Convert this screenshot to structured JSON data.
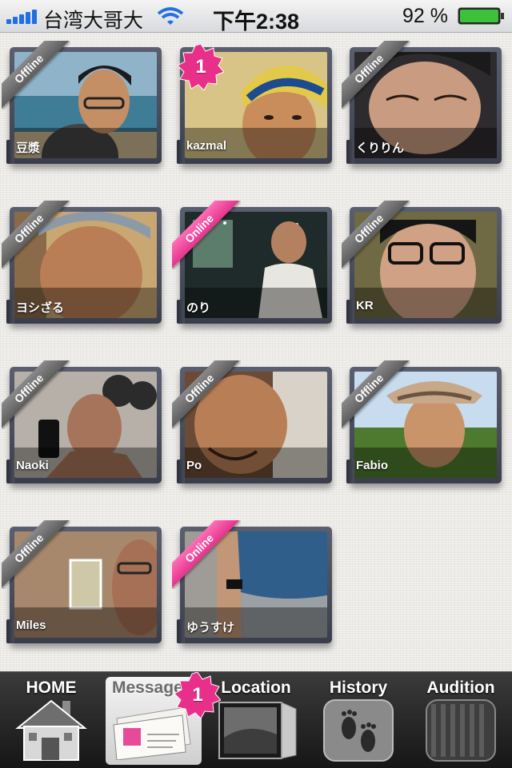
{
  "status_bar": {
    "carrier": "台湾大哥大",
    "time": "下午2:38",
    "battery_percent": "92 %"
  },
  "cards": [
    {
      "name": "豆漿",
      "status": "Offline",
      "badge": ""
    },
    {
      "name": "kazmal",
      "status": "",
      "badge": "1"
    },
    {
      "name": "くりりん",
      "status": "Offline",
      "badge": ""
    },
    {
      "name": "ヨシざる",
      "status": "Offline",
      "badge": ""
    },
    {
      "name": "のり",
      "status": "Online",
      "badge": ""
    },
    {
      "name": "KR",
      "status": "Offline",
      "badge": ""
    },
    {
      "name": "Naoki",
      "status": "Offline",
      "badge": ""
    },
    {
      "name": "Po",
      "status": "Offline",
      "badge": ""
    },
    {
      "name": "Fabio",
      "status": "Offline",
      "badge": ""
    },
    {
      "name": "Miles",
      "status": "Offline",
      "badge": ""
    },
    {
      "name": "ゆうすけ",
      "status": "Online",
      "badge": ""
    }
  ],
  "tabbar": {
    "home": "HOME",
    "message": "Message",
    "message_badge": "1",
    "location": "Location",
    "history": "History",
    "audition": "Audition"
  },
  "colors": {
    "online": "#e4338c",
    "offline": "#6e6e6e",
    "badge": "#e8308a",
    "signal": "#1f6fe6",
    "battery": "#3cc13a"
  }
}
